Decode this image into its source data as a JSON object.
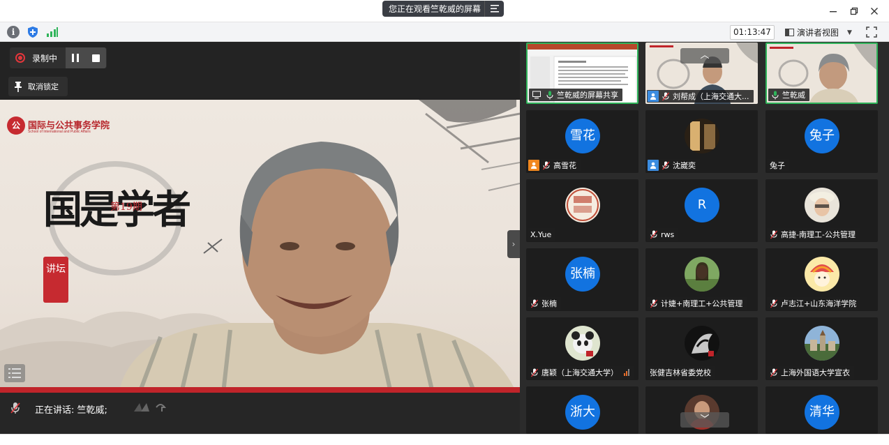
{
  "titlebar": {
    "share_notice": "您正在观看竺乾威的屏幕"
  },
  "toolbar": {
    "timer": "01:13:47",
    "view_mode": "演讲者视图"
  },
  "main": {
    "recording_label": "录制中",
    "unpin_label": "取消锁定",
    "speaking_label": "正在讲话: 竺乾威;",
    "slide": {
      "school_logo_text": "公",
      "school_name": "国际与公共事务学院",
      "school_name_en": "School of International and Public Affairs",
      "issue": "第19期",
      "title": "国是学者",
      "seal": "讲坛"
    }
  },
  "gallery": {
    "tiles": [
      {
        "name": "竺乾威的屏幕共享",
        "type": "screen"
      },
      {
        "name": "刘帮成（上海交通大...",
        "type": "video",
        "badge": "host"
      },
      {
        "name": "竺乾威",
        "type": "video",
        "active": true
      },
      {
        "name": "高雪花",
        "type": "avatar",
        "avatar_text": "雪花",
        "badge": "cohost"
      },
      {
        "name": "沈崴奕",
        "type": "photo",
        "badge": "host"
      },
      {
        "name": "兔子",
        "type": "avatar",
        "avatar_text": "兔子"
      },
      {
        "name": "X.Yue",
        "type": "photo"
      },
      {
        "name": "rws",
        "type": "avatar",
        "avatar_text": "R"
      },
      {
        "name": "高捷-南理工-公共管理",
        "type": "photo"
      },
      {
        "name": "张楠",
        "type": "avatar",
        "avatar_text": "张楠"
      },
      {
        "name": "计婕+南理工+公共管理",
        "type": "photo"
      },
      {
        "name": "卢志江+山东海洋学院",
        "type": "photo"
      },
      {
        "name": "唐颖（上海交通大学）",
        "type": "photo",
        "signal": true
      },
      {
        "name": "张健吉林省委党校",
        "type": "photo"
      },
      {
        "name": "上海外国语大学宣衣",
        "type": "photo"
      },
      {
        "name": "",
        "type": "avatar",
        "avatar_text": "浙大"
      },
      {
        "name": "",
        "type": "photo"
      },
      {
        "name": "",
        "type": "avatar",
        "avatar_text": "清华"
      }
    ]
  },
  "colors": {
    "accent_green": "#2fb45a",
    "avatar_blue": "#1273e0",
    "record_red": "#e3363b",
    "slide_red": "#c0242a"
  }
}
